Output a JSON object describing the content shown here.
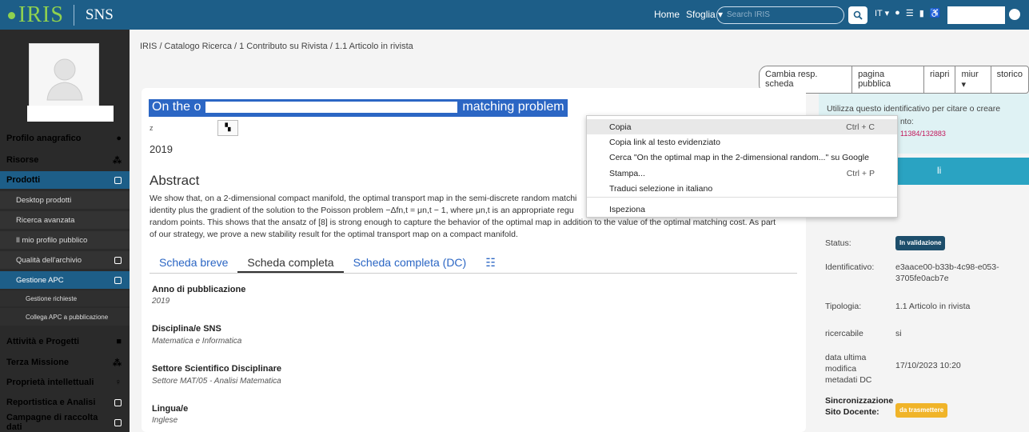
{
  "header": {
    "logo_text": "IRIS",
    "institution": "SNS",
    "nav_home": "Home",
    "nav_browse": "Sfoglia ▾",
    "search_placeholder": "Search IRIS",
    "lang": "IT ▾"
  },
  "sidebar": {
    "items": [
      {
        "label": "Profilo anagrafico"
      },
      {
        "label": "Risorse"
      },
      {
        "label": "Prodotti"
      },
      {
        "label": "Desktop prodotti"
      },
      {
        "label": "Ricerca avanzata"
      },
      {
        "label": "Il mio profilo pubblico"
      },
      {
        "label": "Qualità dell'archivio"
      },
      {
        "label": "Gestione APC"
      },
      {
        "label": "Gestione richieste"
      },
      {
        "label": "Collega APC a pubblicazione"
      },
      {
        "label": "Attività e Progetti"
      },
      {
        "label": "Terza Missione"
      },
      {
        "label": "Proprietà intellettuali"
      },
      {
        "label": "Reportistica e Analisi"
      },
      {
        "label": "Campagne di raccolta dati"
      }
    ]
  },
  "breadcrumb": "IRIS / Catalogo Ricerca / 1 Contributo su Rivista / 1.1 Articolo in rivista",
  "actions": [
    "Cambia resp. scheda",
    "pagina pubblica",
    "riapri",
    "miur ▾",
    "storico"
  ],
  "record": {
    "title_start": "On the o",
    "title_end": "matching problem",
    "author_initial": "z",
    "year": "2019",
    "abstract_heading": "Abstract",
    "abstract_line1": "We show that, on a 2-dimensional compact manifold, the optimal transport map in the semi-discrete random matchi",
    "abstract_line2": "identity plus the gradient of the solution to the Poisson problem −Δfn,t = μn,t − 1, where μn,t is an appropriate regu",
    "abstract_line3": "random points. This shows that the ansatz of [8] is strong enough to capture the behavior of the optimal map in addition to the value of the optimal matching cost. As part",
    "abstract_line4": "of our strategy, we prove a new stability result for the optimal transport map on a compact manifold.",
    "tabs": [
      "Scheda breve",
      "Scheda completa",
      "Scheda completa (DC)"
    ],
    "fields": [
      {
        "label": "Anno di pubblicazione",
        "value": "2019"
      },
      {
        "label": "Disciplina/e SNS",
        "value": "Matematica e Informatica"
      },
      {
        "label": "Settore Scientifico Disciplinare",
        "value": "Settore MAT/05 - Analisi Matematica"
      },
      {
        "label": "Lingua/e",
        "value": "Inglese"
      }
    ]
  },
  "right": {
    "info_text": "Utilizza questo identificativo per citare o creare",
    "info_text2": "nto:",
    "handle": "11384/132883",
    "header_fragment": "li",
    "status_label": "Status:",
    "status_value": "In validazione",
    "id_label": "Identificativo:",
    "id_value": "e3aace00-b33b-4c98-e053-3705fe0acb7e",
    "type_label": "Tipologia:",
    "type_value": "1.1 Articolo in rivista",
    "search_label": "ricercabile",
    "search_value": "si",
    "date_label": "data ultima modifica metadati DC",
    "date_value": "17/10/2023 10:20",
    "sync_label": "Sincronizzazione Sito Docente:",
    "sync_value": "da trasmettere"
  },
  "context_menu": {
    "items": [
      {
        "label": "Copia",
        "shortcut": "Ctrl + C"
      },
      {
        "label": "Copia link al testo evidenziato",
        "shortcut": ""
      },
      {
        "label": "Cerca \"On the optimal map in the 2-dimensional random...\" su Google",
        "shortcut": ""
      },
      {
        "label": "Stampa...",
        "shortcut": "Ctrl + P"
      },
      {
        "label": "Traduci selezione in italiano",
        "shortcut": ""
      },
      {
        "label": "Ispeziona",
        "shortcut": ""
      }
    ]
  },
  "colors": {
    "topbar": "#1d5e88",
    "sidebar": "#2a2a2a",
    "selection": "#2b66c4",
    "accent": "#2aa3c2"
  }
}
